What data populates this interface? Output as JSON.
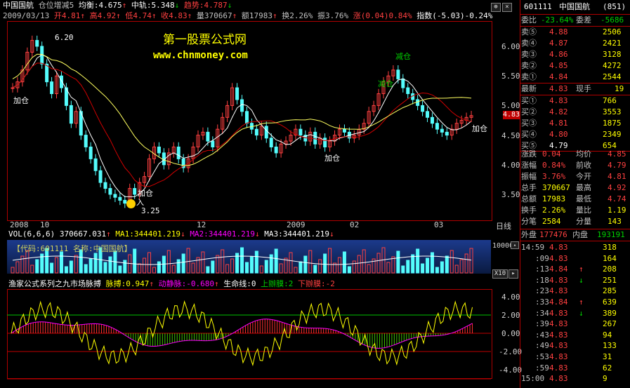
{
  "header": {
    "line1": {
      "name": "中国国航",
      "indicator": "仓位增减5",
      "avg": "均衡:4.675",
      "avg_arrow": "↑",
      "mid": "中轨:5.348",
      "mid_arrow": "↓",
      "trend": "趋势:4.787",
      "trend_arrow": "↓"
    },
    "line2": {
      "date": "2009/03/13",
      "open": "开4.81",
      "open_arrow": "↑",
      "high": "高4.92",
      "high_arrow": "↑",
      "low": "低4.74",
      "low_arrow": "↑",
      "close": "收4.83",
      "close_arrow": "↑",
      "volume": "量370667",
      "volume_arrow": "↑",
      "amount": "额17983",
      "amount_arrow": "↑",
      "turnover": "换2.26%",
      "amplitude": "振3.76%",
      "change": "涨(0.04)0.84%",
      "index": "指数(-5.03)-0.24%"
    }
  },
  "watermark": {
    "title": "第一股票公式网",
    "url": "www.chnmoney.com"
  },
  "price_axis": [
    "6.00",
    "5.50",
    "5.00",
    "4.50",
    "4.00",
    "3.50"
  ],
  "current_price_tag": "4.83",
  "annotations": {
    "high_label": "6.20",
    "low_label": "3.25",
    "add1": "加仓",
    "add2": "加仓",
    "add3": "加仓",
    "add4": "加仓",
    "reduce1": "减仓",
    "reduce2": "减仓",
    "buy": "入"
  },
  "time_axis": [
    "2008",
    "10",
    "12",
    "2009",
    "02",
    "03"
  ],
  "time_axis_right": "日线",
  "volume_panel": {
    "label": "VOL(6,6,6)",
    "value": "370667.031",
    "arrow": "↑",
    "ma1": "MA1:344401.219",
    "ma2": "MA2:344401.219",
    "ma3": "MA3:344401.219",
    "code_label": "【代码:601111 名称:中国国航】",
    "axis_top": "100000",
    "x10": "X10"
  },
  "osc_panel": {
    "title": "渔家公式系列之九市场脉搏",
    "pulse": "脉搏:0.947",
    "dynamic": "动静脉:-0.680",
    "life": "生命线:0",
    "upper": "上辦膜:2",
    "lower": "下辦膜:-2",
    "axis": [
      "4.00",
      "2.00",
      "0.00",
      "-2.00",
      "-4.00"
    ]
  },
  "quote": {
    "code": "601111",
    "name": "中国国航",
    "num": "(851)",
    "weibi_label": "委比",
    "weibi": "-23.64%",
    "weicha_label": "委差",
    "weicha": "-5686",
    "sells": [
      {
        "label": "卖⑤",
        "price": "4.88",
        "vol": "2506"
      },
      {
        "label": "卖④",
        "price": "4.87",
        "vol": "2421"
      },
      {
        "label": "卖③",
        "price": "4.86",
        "vol": "3128"
      },
      {
        "label": "卖②",
        "price": "4.85",
        "vol": "4272"
      },
      {
        "label": "卖①",
        "price": "4.84",
        "vol": "2544"
      }
    ],
    "latest_label": "最新",
    "latest": "4.83",
    "now_hand_label": "现手",
    "now_hand": "19",
    "buys": [
      {
        "label": "买①",
        "price": "4.83",
        "vol": "766"
      },
      {
        "label": "买②",
        "price": "4.82",
        "vol": "3553"
      },
      {
        "label": "买③",
        "price": "4.81",
        "vol": "1875"
      },
      {
        "label": "买④",
        "price": "4.80",
        "vol": "2349"
      },
      {
        "label": "买⑤",
        "price": "4.79",
        "vol": "654"
      }
    ],
    "stats": [
      {
        "l1": "涨跌",
        "v1": "0.04",
        "l2": "均价",
        "v2": "4.85"
      },
      {
        "l1": "涨幅",
        "v1": "0.84%",
        "l2": "前收",
        "v2": "4.79"
      },
      {
        "l1": "振幅",
        "v1": "3.76%",
        "l2": "今开",
        "v2": "4.81"
      },
      {
        "l1": "总手",
        "v1": "370667",
        "l2": "最高",
        "v2": "4.92"
      },
      {
        "l1": "总额",
        "v1": "17983",
        "l2": "最低",
        "v2": "4.74"
      },
      {
        "l1": "换手",
        "v1": "2.26%",
        "l2": "量比",
        "v2": "1.19"
      },
      {
        "l1": "分笔",
        "v1": "2584",
        "l2": "分量",
        "v2": "143"
      }
    ],
    "outer_label": "外盘",
    "outer": "177476",
    "inner_label": "内盘",
    "inner": "193191",
    "ticks": [
      {
        "time": "14:59",
        "price": "4.83",
        "vol": "318",
        "arrow": ""
      },
      {
        "time": ":09",
        "price": "4.83",
        "vol": "164",
        "arrow": ""
      },
      {
        "time": ":13",
        "price": "4.84",
        "vol": "208",
        "arrow": "↑"
      },
      {
        "time": ":18",
        "price": "4.83",
        "vol": "251",
        "arrow": "↓"
      },
      {
        "time": ":23",
        "price": "4.83",
        "vol": "285",
        "arrow": ""
      },
      {
        "time": ":33",
        "price": "4.84",
        "vol": "639",
        "arrow": "↑"
      },
      {
        "time": ":34",
        "price": "4.83",
        "vol": "389",
        "arrow": "↓"
      },
      {
        "time": ":39",
        "price": "4.83",
        "vol": "267",
        "arrow": ""
      },
      {
        "time": ":43",
        "price": "4.83",
        "vol": "94",
        "arrow": ""
      },
      {
        "time": ":49",
        "price": "4.83",
        "vol": "133",
        "arrow": ""
      },
      {
        "time": ":53",
        "price": "4.83",
        "vol": "31",
        "arrow": ""
      },
      {
        "time": ":59",
        "price": "4.83",
        "vol": "62",
        "arrow": ""
      },
      {
        "time": "15:00",
        "price": "4.83",
        "vol": "9",
        "arrow": ""
      }
    ]
  },
  "colors": {
    "up": "#ff4040",
    "down": "#54fcfc",
    "frame": "#b00000",
    "ma_white": "#ffffff",
    "ma_red": "#d00000",
    "ma_yellow": "#ffff60"
  }
}
